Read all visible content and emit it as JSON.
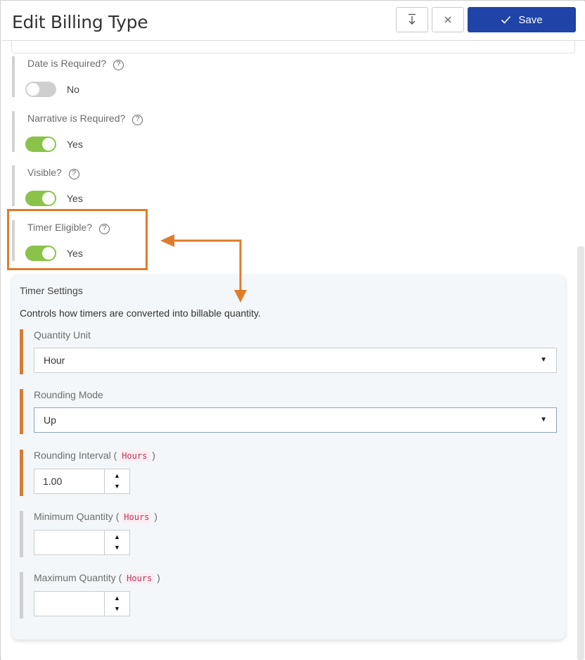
{
  "header": {
    "title": "Edit Billing Type",
    "sort_icon": "download-arrow-icon",
    "close_icon": "close-icon",
    "save_label": "Save"
  },
  "fields": [
    {
      "label": "Date is Required?",
      "value": "No",
      "on": false
    },
    {
      "label": "Narrative is Required?",
      "value": "Yes",
      "on": true
    },
    {
      "label": "Visible?",
      "value": "Yes",
      "on": true
    },
    {
      "label": "Timer Eligible?",
      "value": "Yes",
      "on": true
    }
  ],
  "timer": {
    "title": "Timer Settings",
    "description": "Controls how timers are converted into billable quantity.",
    "quantity_unit": {
      "label": "Quantity Unit",
      "value": "Hour"
    },
    "rounding_mode": {
      "label": "Rounding Mode",
      "value": "Up"
    },
    "rounding_interval": {
      "label": "Rounding Interval",
      "unit": "Hours",
      "value": "1.00"
    },
    "minimum_quantity": {
      "label": "Minimum Quantity",
      "unit": "Hours",
      "value": ""
    },
    "maximum_quantity": {
      "label": "Maximum Quantity",
      "unit": "Hours",
      "value": ""
    }
  },
  "colors": {
    "save_button": "#1f43a6",
    "toggle_on": "#8bc34a",
    "highlight": "#e07b2b",
    "required_bar": "#d67c38"
  }
}
